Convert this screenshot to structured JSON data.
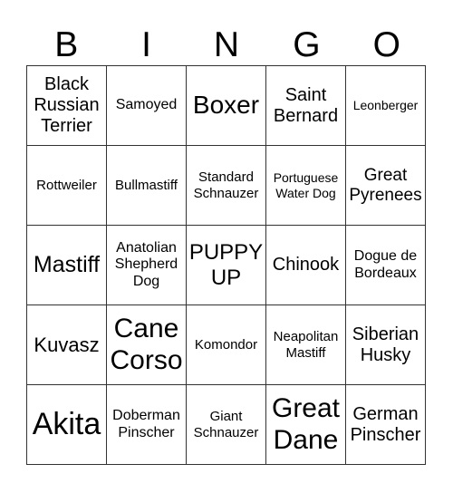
{
  "header": [
    "B",
    "I",
    "N",
    "G",
    "O"
  ],
  "cells": [
    [
      {
        "t": "Black Russian Terrier",
        "s": 20
      },
      {
        "t": "Samoyed",
        "s": 16
      },
      {
        "t": "Boxer",
        "s": 28
      },
      {
        "t": "Saint Bernard",
        "s": 20
      },
      {
        "t": "Leonberger",
        "s": 14
      }
    ],
    [
      {
        "t": "Rottweiler",
        "s": 15
      },
      {
        "t": "Bullmastiff",
        "s": 15
      },
      {
        "t": "Standard Schnauzer",
        "s": 15
      },
      {
        "t": "Portuguese Water Dog",
        "s": 14
      },
      {
        "t": "Great Pyrenees",
        "s": 19
      }
    ],
    [
      {
        "t": "Mastiff",
        "s": 25
      },
      {
        "t": "Anatolian Shepherd Dog",
        "s": 16
      },
      {
        "t": "PUPPY UP",
        "s": 24
      },
      {
        "t": "Chinook",
        "s": 20
      },
      {
        "t": "Dogue de Bordeaux",
        "s": 16
      }
    ],
    [
      {
        "t": "Kuvasz",
        "s": 22
      },
      {
        "t": "Cane Corso",
        "s": 30
      },
      {
        "t": "Komondor",
        "s": 15
      },
      {
        "t": "Neapolitan Mastiff",
        "s": 15
      },
      {
        "t": "Siberian Husky",
        "s": 20
      }
    ],
    [
      {
        "t": "Akita",
        "s": 34
      },
      {
        "t": "Doberman Pinscher",
        "s": 16
      },
      {
        "t": "Giant Schnauzer",
        "s": 15
      },
      {
        "t": "Great Dane",
        "s": 30
      },
      {
        "t": "German Pinscher",
        "s": 20
      }
    ]
  ]
}
